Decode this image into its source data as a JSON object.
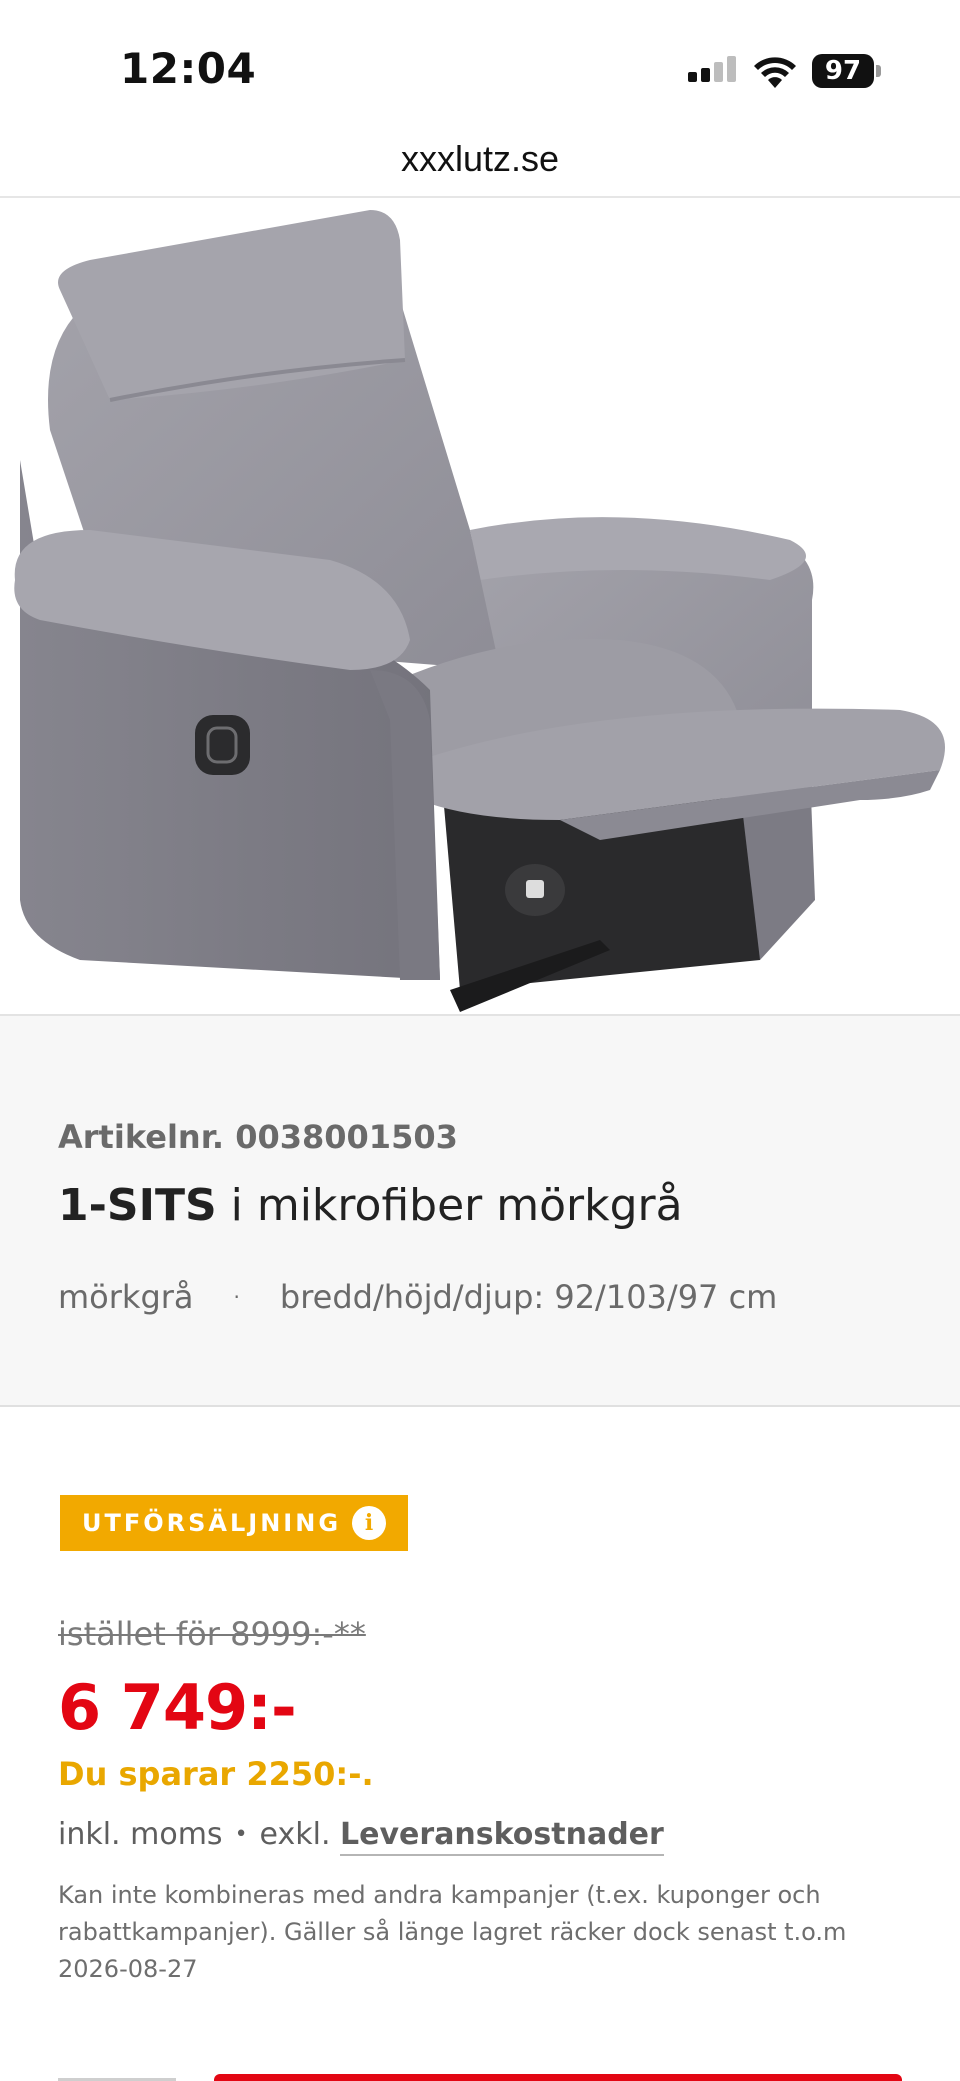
{
  "status_bar": {
    "time": "12:04",
    "battery_level": "97",
    "icons": [
      "cellular-signal-icon",
      "wifi-icon",
      "battery-icon"
    ]
  },
  "browser": {
    "url": "xxxlutz.se"
  },
  "product": {
    "image_alt": "grey recliner armchair",
    "article_number": "Artikelnr. 0038001503",
    "title_bold": "1-SITS",
    "title_rest": " i mikrofiber mörkgrå",
    "color": "mörkgrå",
    "dimensions": "bredd/höjd/djup: 92/103/97 cm"
  },
  "pricing": {
    "badge_label": "UTFÖRSÄLJNING",
    "old_price": "istället för 8999:-**",
    "current_price": "6 749:-",
    "savings": "Du sparar 2250:-.",
    "tax_incl": "inkl. moms",
    "tax_excl_prefix": "exkl.",
    "delivery_link": "Leveranskostnader",
    "disclaimer": "Kan inte kombineras med andra kampanjer (t.ex. kuponger och rabattkampanjer). Gäller så länge lagret räcker dock senast t.o.m 2026-08-27"
  },
  "colors": {
    "price_red": "#e30613",
    "sale_yellow": "#f2a900",
    "savings_yellow": "#e9a700"
  }
}
